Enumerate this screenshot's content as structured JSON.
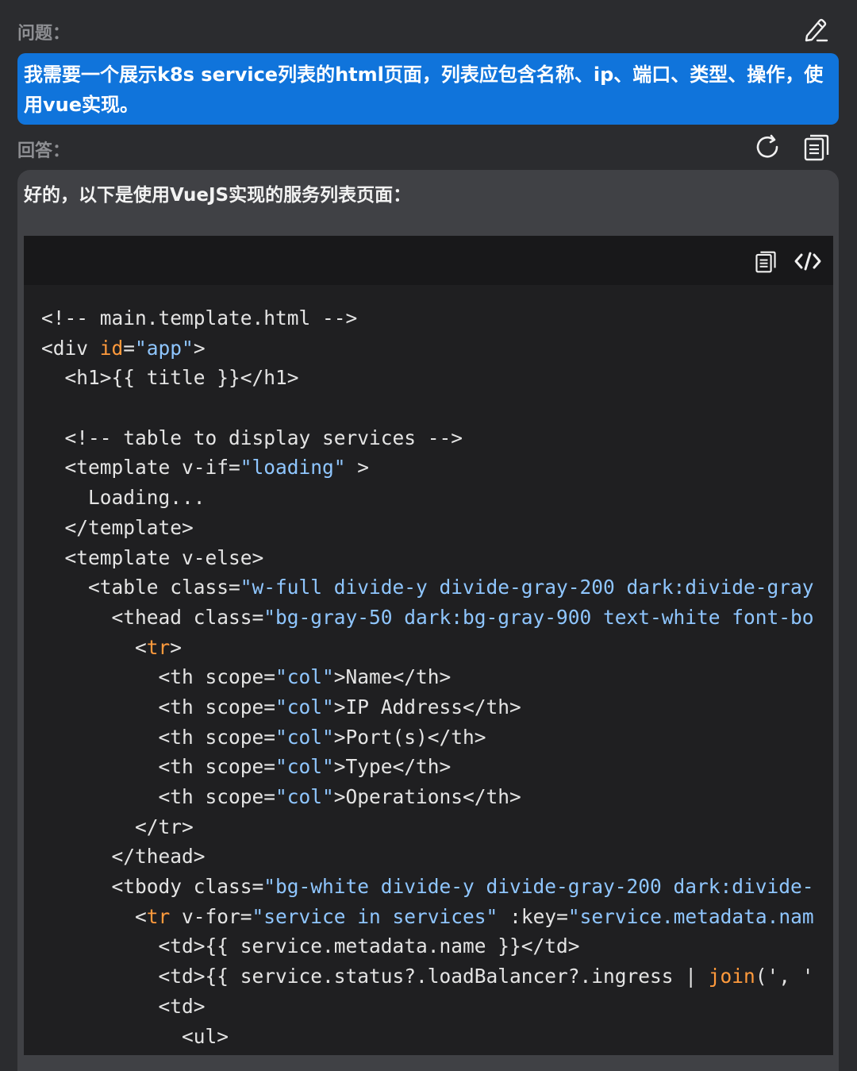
{
  "question": {
    "label": "问题：",
    "text": "我需要一个展示k8s service列表的html页面，列表应包含名称、ip、端口、类型、操作，使用vue实现。"
  },
  "answer": {
    "label": "回答：",
    "intro": "好的，以下是使用VueJS实现的服务列表页面："
  },
  "icons": {
    "edit": "edit-pencil-icon",
    "regenerate": "refresh-icon",
    "copy": "copy-icon",
    "code_copy": "copy-icon",
    "code_view": "code-icon"
  },
  "colors": {
    "question_bg": "#1074db",
    "answer_bg": "#404145",
    "code_bg": "#1f1f21",
    "code_attr": "#ff9a3c",
    "code_string": "#8fc6ff"
  },
  "code": {
    "lines": [
      [
        {
          "t": "<!-- main.template.html -->"
        }
      ],
      [
        {
          "t": "<div "
        },
        {
          "t": "id",
          "c": "attr"
        },
        {
          "t": "="
        },
        {
          "t": "\"app\"",
          "c": "str"
        },
        {
          "t": ">"
        }
      ],
      [
        {
          "t": "  <h1>{{ title }}</h1>"
        }
      ],
      [
        {
          "t": ""
        }
      ],
      [
        {
          "t": "  <!-- table to display services -->"
        }
      ],
      [
        {
          "t": "  <template v-if="
        },
        {
          "t": "\"loading\"",
          "c": "str"
        },
        {
          "t": " >"
        }
      ],
      [
        {
          "t": "    Loading..."
        }
      ],
      [
        {
          "t": "  </template>"
        }
      ],
      [
        {
          "t": "  <template v-else>"
        }
      ],
      [
        {
          "t": "    <table class="
        },
        {
          "t": "\"w-full divide-y divide-gray-200 dark:divide-gray",
          "c": "str"
        }
      ],
      [
        {
          "t": "      <thead class="
        },
        {
          "t": "\"bg-gray-50 dark:bg-gray-900 text-white font-bo",
          "c": "str"
        }
      ],
      [
        {
          "t": "        <"
        },
        {
          "t": "tr",
          "c": "tag"
        },
        {
          "t": ">"
        }
      ],
      [
        {
          "t": "          <th scope="
        },
        {
          "t": "\"col\"",
          "c": "str"
        },
        {
          "t": ">Name</th>"
        }
      ],
      [
        {
          "t": "          <th scope="
        },
        {
          "t": "\"col\"",
          "c": "str"
        },
        {
          "t": ">IP Address</th>"
        }
      ],
      [
        {
          "t": "          <th scope="
        },
        {
          "t": "\"col\"",
          "c": "str"
        },
        {
          "t": ">Port(s)</th>"
        }
      ],
      [
        {
          "t": "          <th scope="
        },
        {
          "t": "\"col\"",
          "c": "str"
        },
        {
          "t": ">Type</th>"
        }
      ],
      [
        {
          "t": "          <th scope="
        },
        {
          "t": "\"col\"",
          "c": "str"
        },
        {
          "t": ">Operations</th>"
        }
      ],
      [
        {
          "t": "        </tr>"
        }
      ],
      [
        {
          "t": "      </thead>"
        }
      ],
      [
        {
          "t": "      <tbody class="
        },
        {
          "t": "\"bg-white divide-y divide-gray-200 dark:divide-",
          "c": "str"
        }
      ],
      [
        {
          "t": "        <"
        },
        {
          "t": "tr",
          "c": "tag"
        },
        {
          "t": " v-for="
        },
        {
          "t": "\"service in services\"",
          "c": "str"
        },
        {
          "t": " :key="
        },
        {
          "t": "\"service.metadata.nam",
          "c": "str"
        }
      ],
      [
        {
          "t": "          <td>{{ service.metadata.name }}</td>"
        }
      ],
      [
        {
          "t": "          <td>{{ service.status?.loadBalancer?.ingress | "
        },
        {
          "t": "join",
          "c": "attr"
        },
        {
          "t": "(', '"
        }
      ],
      [
        {
          "t": "          <td>"
        }
      ],
      [
        {
          "t": "            <ul>"
        }
      ]
    ]
  }
}
